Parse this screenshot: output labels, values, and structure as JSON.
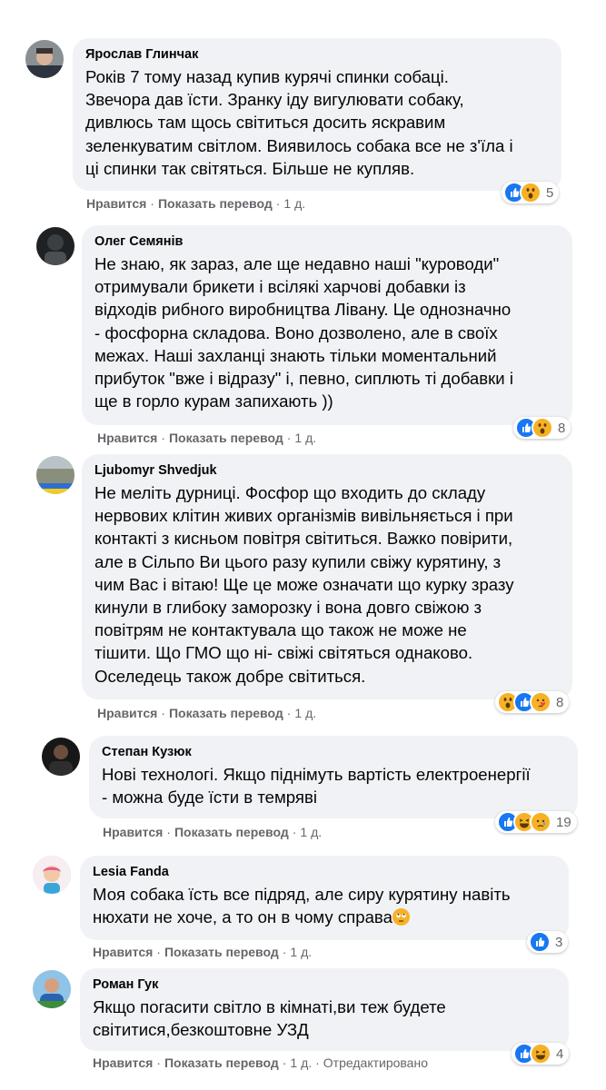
{
  "actions": {
    "like_label": "Нравится",
    "translate_label": "Показать перевод",
    "separator": "·"
  },
  "comments": [
    {
      "author": "Ярослав Глинчак",
      "text": "Років 7 тому назад купив курячі спинки собаці.\nЗвечора дав їсти. Зранку іду вигулювати собаку,\nдивлюсь там щось світиться досить яскравим\nзеленкуватим світлом. Виявилось собака все не з'їла і\nці спинки так світяться. Більше не купляв.",
      "time": "1 д.",
      "reactions": [
        "like-icon",
        "wow-icon"
      ],
      "reaction_count": "5"
    },
    {
      "author": "Олег Семянів",
      "text": "Не знаю, як зараз, але ще недавно наші \"куроводи\"\nотримували брикети і всілякі харчові добавки із\nвідходів рибного виробництва Лівану. Це однозначно\n- фосфорна складова. Воно дозволено, але в своїх\nмежах. Наші захланці знають тільки моментальний\nприбуток \"вже і відразу\" і, певно, сиплють ті добавки і\nще в горло курам запихають ))",
      "time": "1 д.",
      "reactions": [
        "like-icon",
        "wow-icon"
      ],
      "reaction_count": "8"
    },
    {
      "author": "Ljubomyr Shvedjuk",
      "text": "Не меліть дурниці. Фосфор що входить до складу\nнервових клітин живих організмів вивільняється і при\nконтакті з кисньом повітря світиться. Важко повірити,\nале в Сільпо Ви цього разу купили свіжу курятину, з\nчим Вас і вітаю! Ще це може означати що курку зразу\nкинули в глибоку заморозку і вона довго свіжою з\nповітрям не контактувала що також не може не\nтішити. Що ГМО що ні- свіжі світяться однаково.\nОселедець також добре світиться.",
      "time": "1 д.",
      "reactions": [
        "wow-icon",
        "like-icon",
        "care-icon"
      ],
      "reaction_count": "8"
    },
    {
      "author": "Степан Кузюк",
      "text": "Нові технологі. Якщо піднімуть вартість електроенергії\n- можна буде їсти в темряві",
      "time": "1 д.",
      "reactions": [
        "like-icon",
        "haha-icon",
        "sad-icon"
      ],
      "reaction_count": "19"
    },
    {
      "author": "Lesia Fanda",
      "text": "Моя собака їсть все підряд, але сиру курятину навіть\nнюхати не хоче, а то он в чому справа",
      "time": "1 д.",
      "reactions": [
        "like-icon"
      ],
      "reaction_count": "3"
    },
    {
      "author": "Роман Гук",
      "text": "Якщо погасити світло в кімнаті,ви теж будете\nсвітитися,безкоштовне УЗД",
      "time": "1 д.",
      "edited": "Отредактировано",
      "reactions": [
        "like-icon",
        "haha-icon"
      ],
      "reaction_count": "4"
    }
  ],
  "colors": {
    "bubble": "#f0f2f5",
    "secondary_text": "#65676b",
    "like_blue": "#1877f2",
    "emoji_yellow": "#f7b125"
  }
}
